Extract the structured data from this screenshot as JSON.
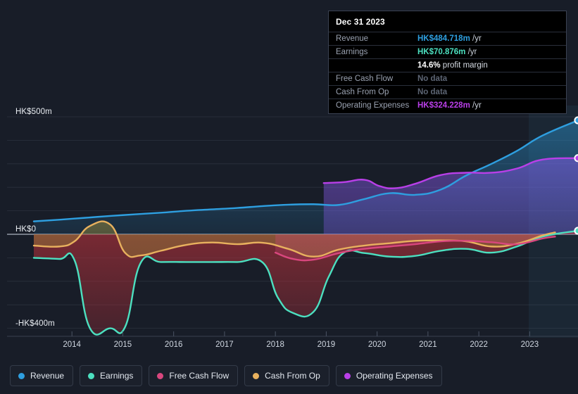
{
  "background_color": "#181d28",
  "tooltip": {
    "date": "Dec 31 2023",
    "rows": [
      {
        "key": "Revenue",
        "amount": "HK$484.718m",
        "unit": "/yr",
        "color": "#2e9fe0",
        "no_data": false
      },
      {
        "key": "Earnings",
        "amount": "HK$70.876m",
        "unit": "/yr",
        "color": "#4ce0c0",
        "no_data": false
      },
      {
        "key": "",
        "amount": "14.6%",
        "unit": "profit margin",
        "color": "#ffffff",
        "no_data": false
      },
      {
        "key": "Free Cash Flow",
        "amount": "No data",
        "unit": "",
        "color": "#5d6574",
        "no_data": true
      },
      {
        "key": "Cash From Op",
        "amount": "No data",
        "unit": "",
        "color": "#5d6574",
        "no_data": true
      },
      {
        "key": "Operating Expenses",
        "amount": "HK$324.228m",
        "unit": "/yr",
        "color": "#b93fe8",
        "no_data": false
      }
    ]
  },
  "legend": {
    "items": [
      {
        "label": "Revenue",
        "color": "#2e9fe0"
      },
      {
        "label": "Earnings",
        "color": "#4ce0c0"
      },
      {
        "label": "Free Cash Flow",
        "color": "#d9477e"
      },
      {
        "label": "Cash From Op",
        "color": "#e8b15e"
      },
      {
        "label": "Operating Expenses",
        "color": "#b93fe8"
      }
    ]
  },
  "chart_data": {
    "type": "line",
    "title": "",
    "xlabel": "",
    "ylabel": "",
    "currency": "HK$",
    "units": "m",
    "grid": true,
    "legend_position": "bottom",
    "ylim": [
      -440,
      560
    ],
    "yticks": [
      -400,
      0,
      500
    ],
    "ytick_labels": [
      "-HK$400m",
      "HK$0",
      "HK$500m"
    ],
    "gridline_values": [
      500,
      400,
      300,
      200,
      100,
      0,
      -100,
      -200,
      -300,
      -400
    ],
    "xlim": [
      2013.25,
      2023.95
    ],
    "xticks": [
      2014,
      2015,
      2016,
      2017,
      2018,
      2019,
      2020,
      2021,
      2022,
      2023
    ],
    "xtick_labels": [
      "2014",
      "2015",
      "2016",
      "2017",
      "2018",
      "2019",
      "2020",
      "2021",
      "2022",
      "2023"
    ],
    "forecast_band_start": 2022.98,
    "series": [
      {
        "name": "Revenue",
        "color": "#2e9fe0",
        "fill": true,
        "endpoint_marker": true,
        "x": [
          2013.25,
          2013.75,
          2014.25,
          2014.75,
          2015.25,
          2015.75,
          2016.25,
          2016.75,
          2017.25,
          2017.75,
          2018.25,
          2018.75,
          2019.25,
          2019.75,
          2020.25,
          2020.75,
          2021.25,
          2021.75,
          2022.25,
          2022.75,
          2023.25,
          2023.95
        ],
        "y": [
          55,
          62,
          70,
          78,
          85,
          92,
          100,
          106,
          112,
          120,
          126,
          128,
          125,
          150,
          175,
          168,
          190,
          250,
          300,
          355,
          420,
          485
        ]
      },
      {
        "name": "Earnings",
        "color": "#4ce0c0",
        "fill": true,
        "endpoint_marker": true,
        "x": [
          2013.25,
          2013.75,
          2014.05,
          2014.35,
          2014.75,
          2015.05,
          2015.35,
          2015.75,
          2016.25,
          2016.75,
          2017.25,
          2017.75,
          2018.05,
          2018.35,
          2018.75,
          2019.05,
          2019.35,
          2019.75,
          2020.25,
          2020.75,
          2021.25,
          2021.75,
          2022.25,
          2022.75,
          2023.25,
          2023.95
        ],
        "y": [
          -100,
          -105,
          -110,
          -398,
          -400,
          -392,
          -122,
          -118,
          -118,
          -118,
          -118,
          -120,
          -270,
          -335,
          -330,
          -180,
          -78,
          -80,
          -95,
          -92,
          -70,
          -62,
          -78,
          -52,
          -10,
          15
        ]
      },
      {
        "name": "Free Cash Flow",
        "color": "#d9477e",
        "fill": true,
        "endpoint_marker": false,
        "x": [
          2018.0,
          2018.35,
          2018.75,
          2019.25,
          2019.75,
          2020.25,
          2020.75,
          2021.25,
          2021.75,
          2022.25,
          2022.75,
          2023.25,
          2023.5
        ],
        "y": [
          -78,
          -105,
          -108,
          -80,
          -62,
          -52,
          -42,
          -30,
          -28,
          -34,
          -42,
          -18,
          -10
        ]
      },
      {
        "name": "Cash From Op",
        "color": "#e8b15e",
        "fill": true,
        "endpoint_marker": false,
        "x": [
          2013.25,
          2013.75,
          2014.05,
          2014.35,
          2014.75,
          2015.05,
          2015.35,
          2015.75,
          2016.25,
          2016.75,
          2017.25,
          2017.75,
          2018.25,
          2018.75,
          2019.25,
          2019.75,
          2020.25,
          2020.75,
          2021.25,
          2021.75,
          2022.25,
          2022.75,
          2023.25,
          2023.5
        ],
        "y": [
          -48,
          -52,
          -30,
          35,
          42,
          -80,
          -90,
          -70,
          -45,
          -35,
          -42,
          -36,
          -62,
          -95,
          -65,
          -48,
          -38,
          -28,
          -26,
          -30,
          -52,
          -40,
          -5,
          8
        ]
      },
      {
        "name": "Operating Expenses",
        "color": "#b93fe8",
        "fill": true,
        "endpoint_marker": true,
        "x": [
          2018.95,
          2019.35,
          2019.75,
          2020.05,
          2020.35,
          2020.75,
          2021.25,
          2021.75,
          2022.25,
          2022.75,
          2023.25,
          2023.95
        ],
        "y": [
          218,
          222,
          232,
          205,
          196,
          215,
          252,
          262,
          262,
          280,
          318,
          324
        ]
      }
    ]
  }
}
